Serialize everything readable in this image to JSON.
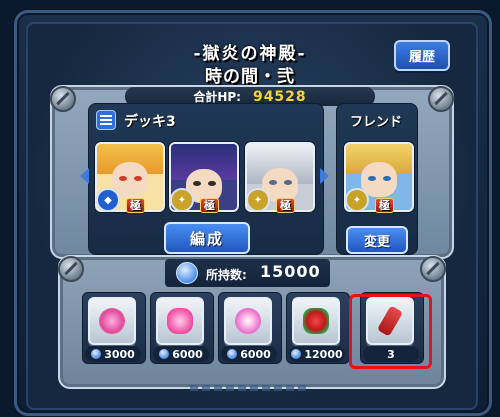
{
  "header": {
    "title": "-獄炎の神殿-",
    "subtitle": "時の間・弐",
    "history_button": "履歴"
  },
  "party": {
    "hp_label": "合計HP:",
    "hp_value": "94528",
    "deck_label": "デッキ3",
    "friend_label": "フレンド",
    "edit_button": "編成",
    "change_button": "変更",
    "rank_tags": [
      "極",
      "極",
      "極",
      "極"
    ]
  },
  "items": {
    "owned_label": "所持数:",
    "owned_value": "15000",
    "list": [
      {
        "name": "speed-up-item",
        "cost": "3000"
      },
      {
        "name": "heart-item",
        "cost": "6000"
      },
      {
        "name": "star-item",
        "cost": "6000"
      },
      {
        "name": "splash-item",
        "cost": "12000"
      },
      {
        "name": "bottle-item",
        "cost": "3"
      }
    ]
  },
  "colors": {
    "highlight": "#e0141b",
    "hp_value": "#f6d33c",
    "button_blue": "#2f6fd8"
  }
}
